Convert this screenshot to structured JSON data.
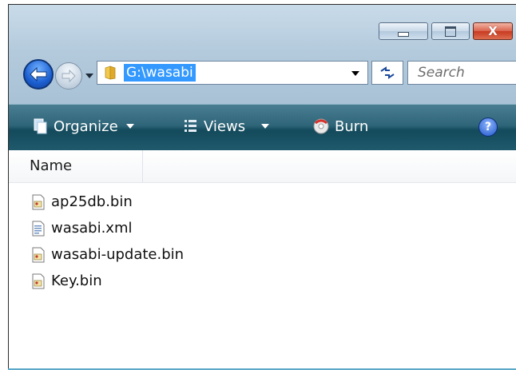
{
  "window": {
    "caption_close_glyph": "X"
  },
  "navigation": {
    "address": "G:\\wasabi",
    "search_placeholder": "Search"
  },
  "toolbar": {
    "organize_label": "Organize",
    "views_label": "Views",
    "burn_label": "Burn",
    "help_glyph": "?"
  },
  "columns": {
    "name_label": "Name"
  },
  "files": [
    {
      "name": "ap25db.bin",
      "icon": "bin-file-icon"
    },
    {
      "name": "wasabi.xml",
      "icon": "xml-file-icon"
    },
    {
      "name": "wasabi-update.bin",
      "icon": "bin-file-icon"
    },
    {
      "name": "Key.bin",
      "icon": "bin-file-icon"
    }
  ],
  "colors": {
    "toolbar": "#1f5a6c",
    "selection": "#3399ff",
    "close_button": "#c73a20"
  }
}
